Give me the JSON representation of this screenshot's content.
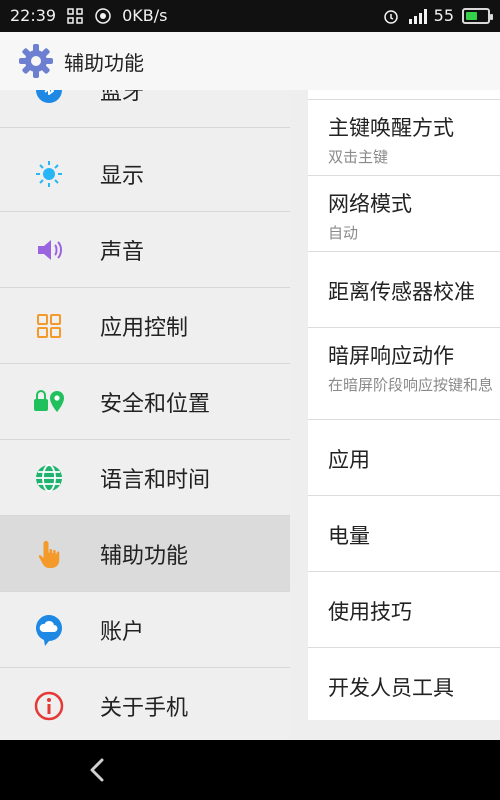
{
  "status_bar": {
    "time": "22:39",
    "speed": "0KB/s",
    "battery": "55",
    "battery_level": 0.55
  },
  "header": {
    "title": "辅助功能",
    "icon": "gear-icon"
  },
  "left_menu": [
    {
      "label": "蓝牙",
      "icon": "bluetooth-icon"
    },
    {
      "label": "显示",
      "icon": "brightness-icon"
    },
    {
      "label": "声音",
      "icon": "speaker-icon"
    },
    {
      "label": "应用控制",
      "icon": "apps-grid-icon"
    },
    {
      "label": "安全和位置",
      "icon": "lock-location-icon"
    },
    {
      "label": "语言和时间",
      "icon": "globe-icon"
    },
    {
      "label": "辅助功能",
      "icon": "hand-pointer-icon",
      "active": true
    },
    {
      "label": "账户",
      "icon": "cloud-account-icon"
    },
    {
      "label": "关于手机",
      "icon": "info-icon"
    }
  ],
  "right_list": [
    {
      "title": "主键唤醒方式",
      "subtitle": "双击主键"
    },
    {
      "title": "网络模式",
      "subtitle": "自动"
    },
    {
      "title": "距离传感器校准",
      "subtitle": ""
    },
    {
      "title": "暗屏响应动作",
      "subtitle": "在暗屏阶段响应按键和息"
    },
    {
      "title": "应用",
      "subtitle": ""
    },
    {
      "title": "电量",
      "subtitle": ""
    },
    {
      "title": "使用技巧",
      "subtitle": ""
    },
    {
      "title": "开发人员工具",
      "subtitle": ""
    }
  ],
  "colors": {
    "accent_blue": "#1e88e5",
    "purple": "#9a63e0",
    "green": "#20c05c",
    "orange": "#f39a2b",
    "red": "#e53935"
  }
}
